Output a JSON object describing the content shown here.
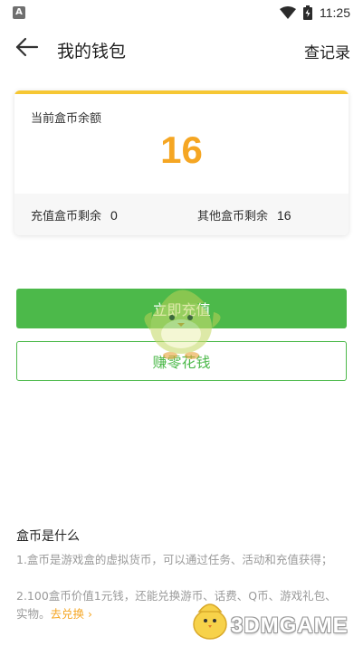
{
  "status_bar": {
    "left_icon_letter": "A",
    "time": "11:25",
    "wifi_icon": "wifi-icon",
    "battery_icon": "battery-icon"
  },
  "header": {
    "back_icon": "arrow-left-icon",
    "title": "我的钱包",
    "records_label": "查记录"
  },
  "balance_card": {
    "label": "当前盒币余额",
    "value": "16",
    "recharge_label": "充值盒币剩余",
    "recharge_value": "0",
    "other_label": "其他盒币剩余",
    "other_value": "16"
  },
  "buttons": {
    "recharge": "立即充值",
    "earn": "赚零花钱"
  },
  "info": {
    "title": "盒币是什么",
    "line1": "1.盒币是游戏盒的虚拟货币，可以通过任务、活动和充值获得；",
    "line2": "2.100盒币价值1元钱，还能兑换游币、话费、Q币、游戏礼包、实物。",
    "exchange_link": "去兑换 ›"
  },
  "watermark": {
    "text": "3DMGAME"
  },
  "colors": {
    "accent_green": "#4cb94a",
    "accent_orange": "#f5a623",
    "card_top_bar": "#f6c733"
  }
}
